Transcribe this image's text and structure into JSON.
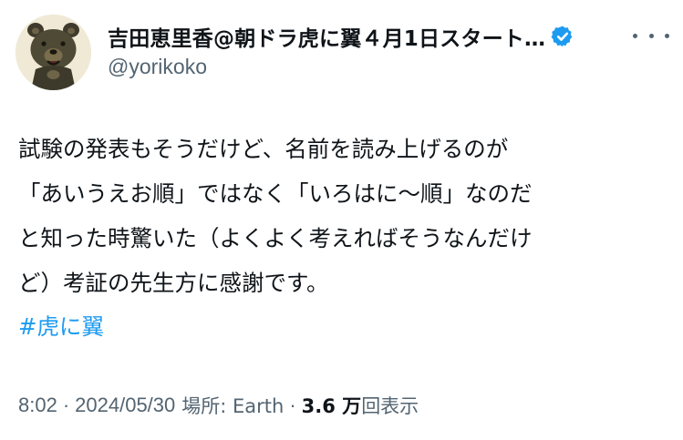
{
  "tweet": {
    "display_name": "吉田恵里香@朝ドラ虎に翼４月1日スタート…",
    "handle": "@yorikoko",
    "verified_badge_color": "#1d9bf0",
    "more_icon": "more-horizontal-icon",
    "body_lines": [
      "試験の発表もそうだけど、名前を読み上げるのが",
      "「あいうえお順」ではなく「いろはに〜順」なのだ",
      "と知った時驚いた（よくよく考えればそうなんだけ",
      "ど）考証の先生方に感謝です。"
    ],
    "hashtag": "#虎に翼",
    "time": "8:02",
    "separator": "·",
    "date": "2024/05/30",
    "location_label": "場所: Earth",
    "views_count": "3.6 万",
    "views_label": "回表示"
  },
  "colors": {
    "text_primary": "#0f1419",
    "text_secondary": "#536471",
    "link": "#1d9bf0"
  }
}
